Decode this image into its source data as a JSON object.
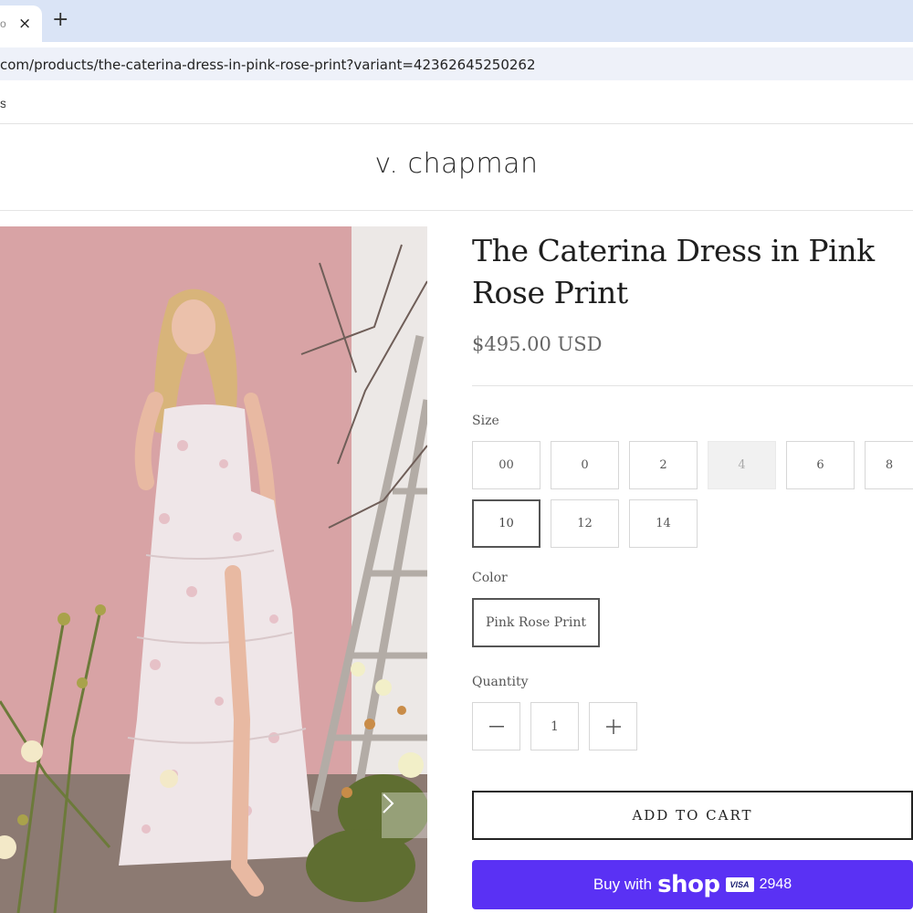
{
  "browser": {
    "tab_title": "o",
    "tab_close_icon": "×",
    "new_tab_icon": "+",
    "url": "com/products/the-caterina-dress-in-pink-rose-print?variant=42362645250262",
    "bookmark_fragment": "s"
  },
  "site": {
    "logo": "v. chapman"
  },
  "product": {
    "title": "The Caterina Dress in Pink Rose Print",
    "price": "$495.00 USD",
    "size_label": "Size",
    "sizes": [
      {
        "label": "00",
        "state": "available"
      },
      {
        "label": "0",
        "state": "available"
      },
      {
        "label": "2",
        "state": "available"
      },
      {
        "label": "4",
        "state": "unavailable"
      },
      {
        "label": "6",
        "state": "available"
      },
      {
        "label": "8",
        "state": "available"
      },
      {
        "label": "10",
        "state": "selected"
      },
      {
        "label": "12",
        "state": "available"
      },
      {
        "label": "14",
        "state": "available"
      }
    ],
    "color_label": "Color",
    "color_value": "Pink Rose Print",
    "quantity_label": "Quantity",
    "quantity_value": "1",
    "decrement_icon": "minus-icon",
    "increment_icon": "plus-icon",
    "add_to_cart": "ADD TO CART"
  },
  "shop_pay": {
    "buy_with": "Buy with",
    "brand": "shop",
    "card_brand": "VISA",
    "card_digits": "2948",
    "color": "#5a31f4"
  },
  "gallery": {
    "next_icon": "chevron-right-icon"
  }
}
